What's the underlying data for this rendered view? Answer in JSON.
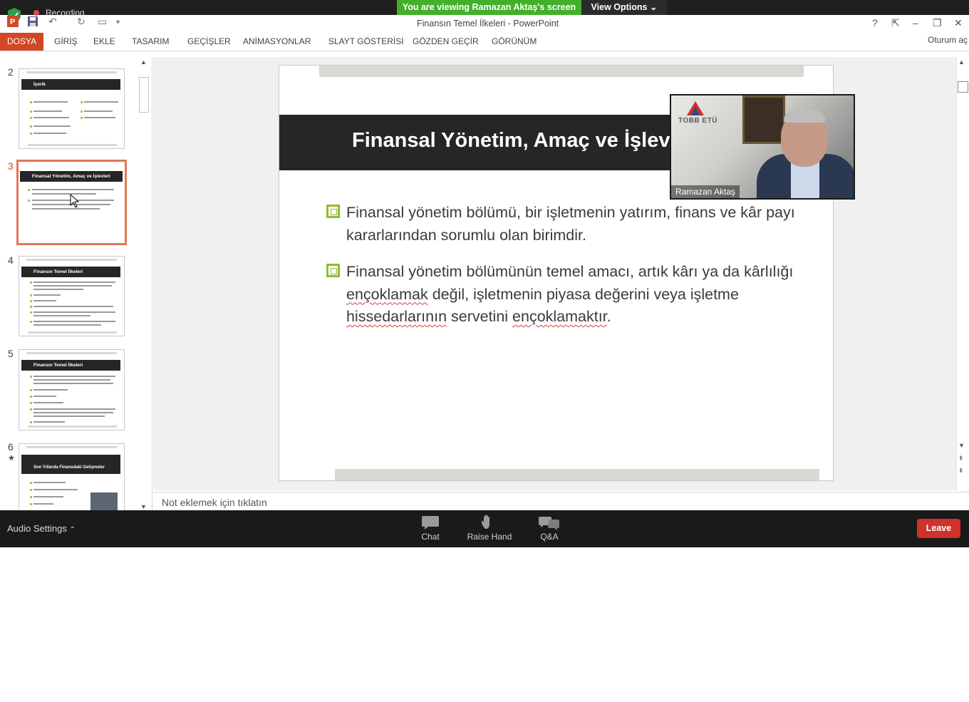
{
  "share": {
    "recording_label": "Recording",
    "viewing_banner": "You are viewing Ramazan Aktaş's screen",
    "view_options_label": "View Options"
  },
  "window": {
    "title": "Finansın Temel İlkeleri - PowerPoint",
    "help": "?",
    "minimize": "–",
    "maximize": "❐",
    "close": "✕"
  },
  "ribbon": {
    "tabs": [
      {
        "label": "DOSYA"
      },
      {
        "label": "GİRİŞ"
      },
      {
        "label": "EKLE"
      },
      {
        "label": "TASARIM"
      },
      {
        "label": "GEÇİŞLER"
      },
      {
        "label": "ANİMASYONLAR"
      },
      {
        "label": "SLAYT GÖSTERİSİ"
      },
      {
        "label": "GÖZDEN GEÇİR"
      },
      {
        "label": "GÖRÜNÜM"
      }
    ],
    "signin": "Oturum aç"
  },
  "thumbnails": [
    {
      "number": "2",
      "title": "İçerik"
    },
    {
      "number": "3",
      "title": "Finansal Yönetim, Amaç ve İşlevleri",
      "selected": true
    },
    {
      "number": "4",
      "title": "Finansın Temel İlkeleri"
    },
    {
      "number": "5",
      "title": "Finansın Temel İlkeleri"
    },
    {
      "number": "6",
      "title": "Son Yıllarda Finansdaki Gelişmeler",
      "star": "★"
    }
  ],
  "slide": {
    "title": "Finansal Yönetim, Amaç ve İşlev",
    "bullet1": "Finansal yönetim bölümü, bir işletmenin yatırım, finans ve kâr payı kararlarından sorumlu olan birimdir.",
    "bullet2_part1": "Finansal yönetim bölümünün temel amacı, artık kârı ya da kârlılığı ",
    "bullet2_spell1": "ençoklamak",
    "bullet2_part2": " değil, işletmenin piyasa değerini veya işletme ",
    "bullet2_spell2": "hissedarlarının",
    "bullet2_part3": " servetini ",
    "bullet2_spell3": "ençoklamaktır",
    "bullet2_end": "."
  },
  "notes": {
    "placeholder": "Not eklemek için tıklatın"
  },
  "webcam": {
    "participant_name": "Ramazan Aktaş",
    "logo_text": "TOBB ETÜ"
  },
  "meeting_bar": {
    "audio_settings": "Audio Settings",
    "chat": "Chat",
    "raise_hand": "Raise Hand",
    "qa": "Q&A",
    "leave": "Leave"
  },
  "colors": {
    "accent_ribbon": "#d24726",
    "banner_green": "#43b02a",
    "leave_red": "#d0312d",
    "bullet_green": "#8fbc2f"
  }
}
